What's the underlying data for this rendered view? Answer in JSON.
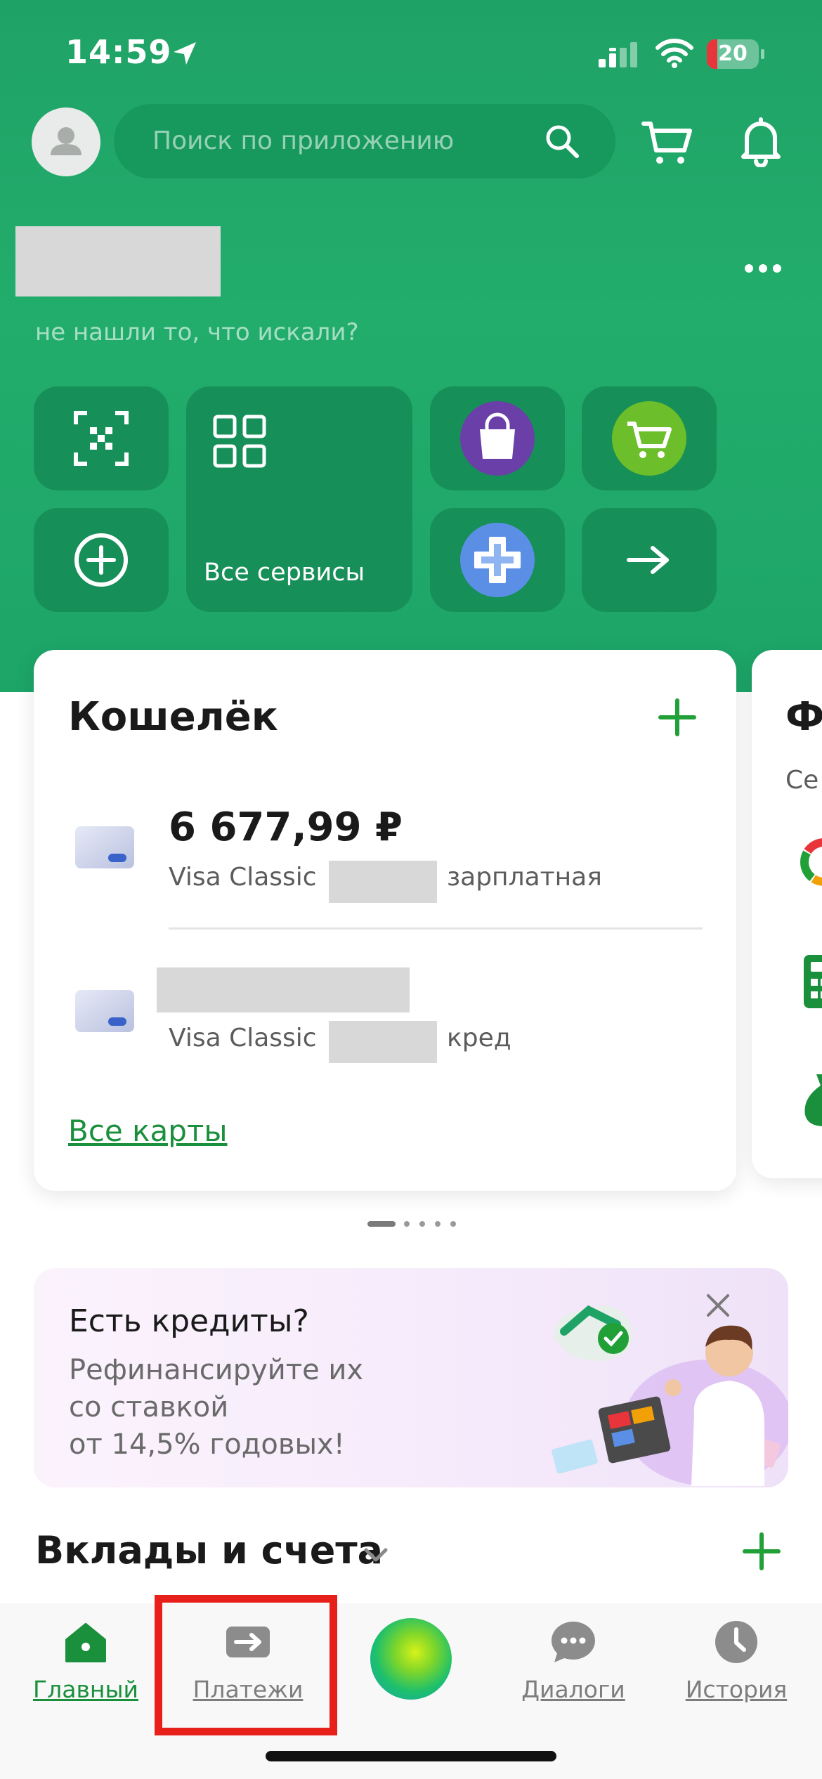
{
  "status_bar": {
    "time": "14:59",
    "battery_level": "20",
    "battery_fraction": 0.2
  },
  "header": {
    "search_placeholder": "Поиск по приложению"
  },
  "greeting": {
    "subtitle": "не нашли то, что искали?"
  },
  "services": {
    "all_services_label": "Все сервисы"
  },
  "wallet": {
    "title": "Кошелёк",
    "cards": [
      {
        "balance": "6 677,99 ₽",
        "type": "Visa Classic",
        "label": "зарплатная"
      },
      {
        "balance": "",
        "type": "Visa Classic",
        "label": "кред"
      }
    ],
    "all_cards_link": "Все карты"
  },
  "next_card": {
    "title_partial": "Ф",
    "subtitle_partial": "Се"
  },
  "promo": {
    "title": "Есть кредиты?",
    "lines": [
      "Рефинансируйте их",
      "со ставкой",
      "от 14,5% годовых!"
    ]
  },
  "deposits": {
    "title": "Вклады и счета"
  },
  "bottom_nav": {
    "items": [
      {
        "label": "Главный",
        "icon": "home-icon",
        "active": true
      },
      {
        "label": "Платежи",
        "icon": "payments-icon",
        "active": false
      },
      {
        "label": "",
        "icon": "assistant-icon",
        "active": false
      },
      {
        "label": "Диалоги",
        "icon": "dialogs-icon",
        "active": false
      },
      {
        "label": "История",
        "icon": "history-icon",
        "active": false
      }
    ]
  },
  "colors": {
    "brand_green": "#21a038",
    "hero_green": "#1fa266",
    "link_green": "#1a8f3c",
    "highlight_red": "#e8201a"
  }
}
